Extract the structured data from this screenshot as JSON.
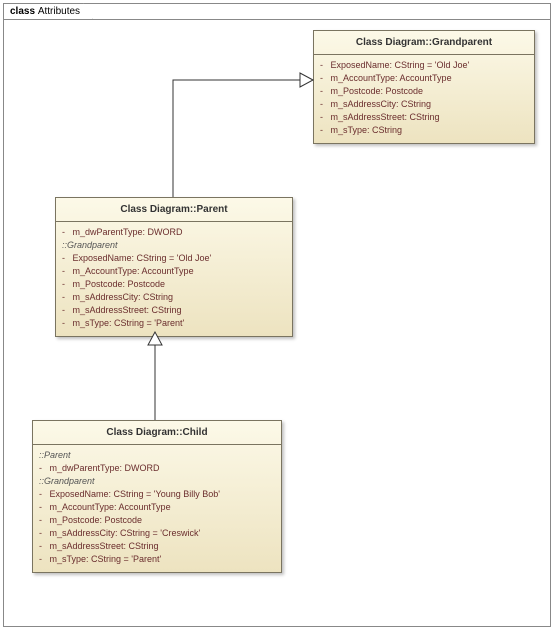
{
  "frame": {
    "label_prefix": "class ",
    "label_name": "Attributes"
  },
  "grandparent": {
    "title": "Class Diagram::Grandparent",
    "attrs": [
      {
        "vis": "-",
        "text": "ExposedName:  CString = 'Old Joe'"
      },
      {
        "vis": "-",
        "text": "m_AccountType:  AccountType"
      },
      {
        "vis": "-",
        "text": "m_Postcode:  Postcode"
      },
      {
        "vis": "-",
        "text": "m_sAddressCity:  CString"
      },
      {
        "vis": "-",
        "text": "m_sAddressStreet:  CString"
      },
      {
        "vis": "-",
        "text": "m_sType:  CString"
      }
    ]
  },
  "parent": {
    "title": "Class Diagram::Parent",
    "own_attrs": [
      {
        "vis": "-",
        "text": "m_dwParentType:  DWORD"
      }
    ],
    "inherited_label": "::Grandparent",
    "inherited_attrs": [
      {
        "vis": "-",
        "text": "ExposedName:  CString = 'Old Joe'"
      },
      {
        "vis": "-",
        "text": "m_AccountType:  AccountType"
      },
      {
        "vis": "-",
        "text": "m_Postcode:  Postcode"
      },
      {
        "vis": "-",
        "text": "m_sAddressCity:  CString"
      },
      {
        "vis": "-",
        "text": "m_sAddressStreet:  CString"
      },
      {
        "vis": "-",
        "text": "m_sType:  CString = 'Parent'"
      }
    ]
  },
  "child": {
    "title": "Class Diagram::Child",
    "section1_label": "::Parent",
    "section1_attrs": [
      {
        "vis": "-",
        "text": "m_dwParentType:  DWORD"
      }
    ],
    "section2_label": "::Grandparent",
    "section2_attrs": [
      {
        "vis": "-",
        "text": "ExposedName:  CString = 'Young Billy Bob'"
      },
      {
        "vis": "-",
        "text": "m_AccountType:  AccountType"
      },
      {
        "vis": "-",
        "text": "m_Postcode:  Postcode"
      },
      {
        "vis": "-",
        "text": "m_sAddressCity:  CString = 'Creswick'"
      },
      {
        "vis": "-",
        "text": "m_sAddressStreet:  CString"
      },
      {
        "vis": "-",
        "text": "m_sType:  CString = 'Parent'"
      }
    ]
  }
}
